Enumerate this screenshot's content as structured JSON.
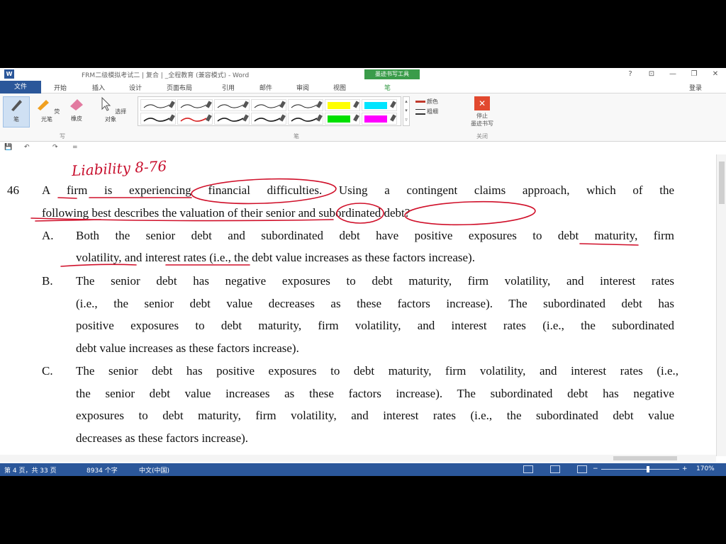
{
  "app": {
    "icon_letter": "W",
    "title": "FRM二级模拟考试二 | 复合 | _全程教育 (兼容模式) - Word",
    "tool_tab": "墨迹书写工具",
    "window_buttons": [
      "?",
      "⊡",
      "—",
      "❐",
      "✕"
    ]
  },
  "tabs": [
    "文件",
    "开始",
    "插入",
    "设计",
    "页面布局",
    "引用",
    "邮件",
    "审阅",
    "视图",
    "笔"
  ],
  "user": "登录",
  "ribbon": {
    "buttons": [
      "笔",
      "荧光笔",
      "橡皮",
      "选择对象"
    ],
    "color_label": "颜色",
    "thickness_label": "粗细",
    "stop_label_1": "停止",
    "stop_label_2": "墨迹书写",
    "group_labels": [
      "写",
      "笔",
      "关闭"
    ],
    "pen_colors": [
      "#1a1a1a",
      "#1a1a1a",
      "#1a1a1a",
      "#1a1a1a",
      "#1a1a1a",
      "#ffff00",
      "#00e5ff",
      "#1a1a1a",
      "#d62020",
      "#1a1a1a",
      "#1a1a1a",
      "#1a1a1a",
      "#00e000",
      "#ff00ff"
    ]
  },
  "qat": [
    "💾",
    "↶",
    "↷",
    "="
  ],
  "document": {
    "handwritten_note": "Liability  8-76",
    "question_number": "46",
    "question_lines": [
      "A firm is experiencing financial difficulties. Using a contingent claims approach, which of the",
      "following best describes the valuation of their senior and subordinated debt?"
    ],
    "options": [
      {
        "label": "A.",
        "lines": [
          "Both the senior debt and subordinated debt have positive exposures to debt maturity, firm",
          "volatility, and interest rates (i.e., the debt value increases as these factors increase)."
        ]
      },
      {
        "label": "B.",
        "lines": [
          "The senior debt has negative exposures to debt maturity, firm volatility, and interest rates",
          "(i.e., the senior debt value decreases as these factors increase). The subordinated debt has",
          "positive exposures to debt maturity, firm volatility, and interest rates (i.e., the subordinated",
          "debt value increases as these factors increase)."
        ]
      },
      {
        "label": "C.",
        "lines": [
          "The senior debt has positive exposures to debt maturity, firm volatility, and interest rates (i.e.,",
          "the senior debt value increases as these factors increase). The subordinated debt has negative",
          "exposures to debt maturity, firm volatility, and interest rates (i.e., the subordinated debt value",
          "decreases as these factors increase)."
        ]
      }
    ]
  },
  "status": {
    "page": "第 4 页，共 33 页",
    "words": "8934 个字",
    "language": "中文(中国)",
    "zoom": "170%"
  }
}
